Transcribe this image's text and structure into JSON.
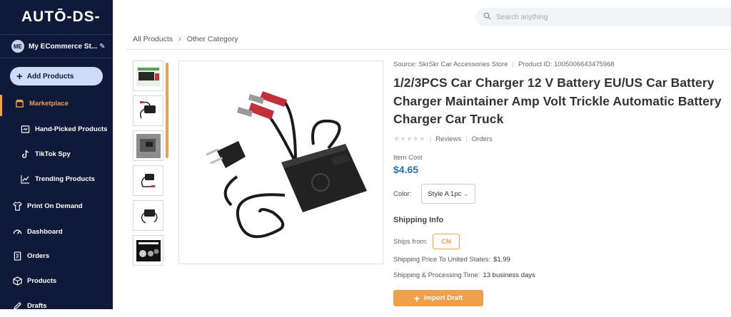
{
  "app": {
    "logo": "AUTŌ-DS-"
  },
  "store": {
    "initials": "ME",
    "name": "My ECommerce St..."
  },
  "sidebar": {
    "add_label": "Add Products",
    "items": [
      {
        "label": "Marketplace",
        "icon": "store-icon"
      },
      {
        "label": "Hand-Picked Products",
        "icon": "hand-picked-icon"
      },
      {
        "label": "TikTok Spy",
        "icon": "tiktok-icon"
      },
      {
        "label": "Trending Products",
        "icon": "trending-icon"
      },
      {
        "label": "Print On Demand",
        "icon": "tshirt-icon"
      },
      {
        "label": "Dashboard",
        "icon": "dashboard-icon"
      },
      {
        "label": "Orders",
        "icon": "orders-icon"
      },
      {
        "label": "Products",
        "icon": "products-icon"
      },
      {
        "label": "Drafts",
        "icon": "drafts-icon"
      }
    ],
    "accent": "#f0a04b",
    "background": "#0f1a3a"
  },
  "search": {
    "placeholder": "Search anything"
  },
  "breadcrumb": [
    "All Products",
    "Other Category"
  ],
  "product": {
    "source": "Source: SkrSkr Car Accessories Store",
    "product_id": "Product ID: 1005006643475968",
    "title": "1/2/3PCS Car Charger 12 V Battery EU/US Car Battery Charger Maintainer Amp Volt Trickle Automatic Battery Charger Car Truck",
    "reviews_label": "Reviews",
    "orders_label": "Orders",
    "rating": 0,
    "item_cost_label": "Item Cost",
    "item_cost": "$4.65",
    "color_label": "Color:",
    "color_value": "Style A  1pc",
    "shipping_title": "Shipping Info",
    "ships_from_label": "Ships from:",
    "ships_from": "CN",
    "ship_price_label": "Shipping Price To United States:",
    "ship_price": "$1.99",
    "ship_time_label": "Shipping & Processing Time:",
    "ship_time": "13 business days",
    "import_label": "Import Draft",
    "cost_color": "#2a6fb8"
  }
}
